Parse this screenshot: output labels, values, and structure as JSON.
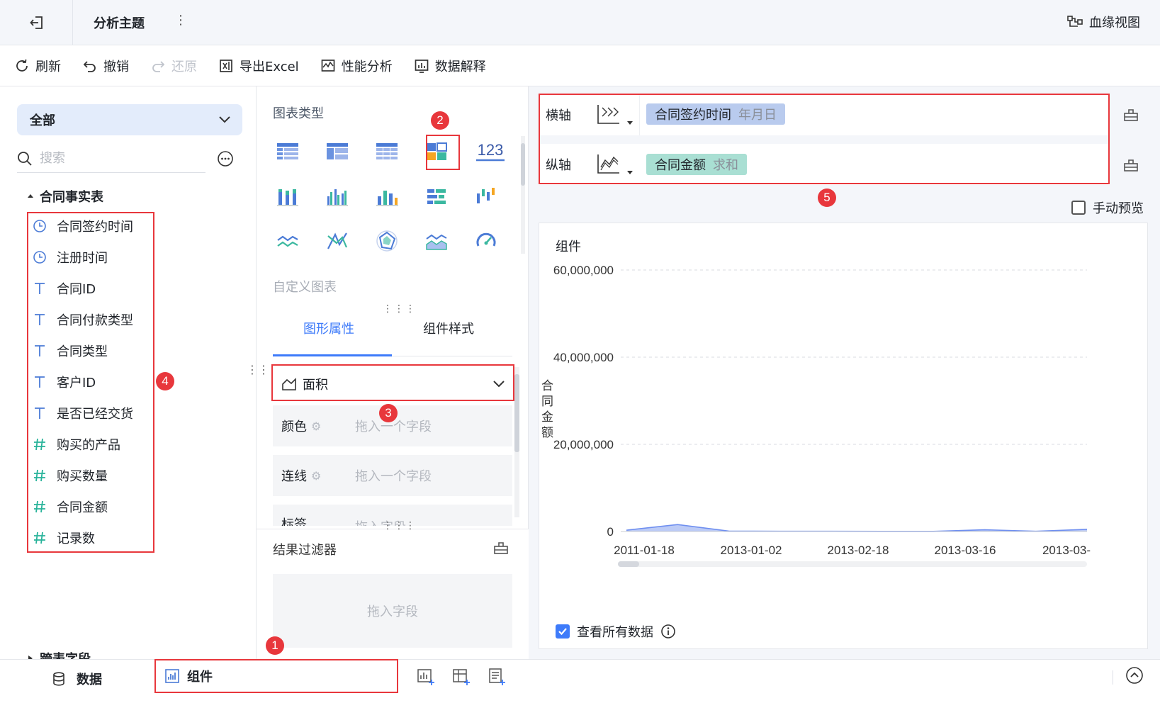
{
  "header": {
    "title": "分析主题",
    "menu_glyph": "⋮",
    "lineage_label": "血缘视图"
  },
  "toolbar": {
    "refresh": "刷新",
    "undo": "撤销",
    "redo": "还原",
    "export_excel": "导出Excel",
    "performance": "性能分析",
    "data_explain": "数据解释"
  },
  "left": {
    "scope": "全部",
    "search_placeholder": "搜索",
    "table_name": "合同事实表",
    "fields": [
      {
        "label": "合同签约时间",
        "type": "date"
      },
      {
        "label": "注册时间",
        "type": "date"
      },
      {
        "label": "合同ID",
        "type": "text"
      },
      {
        "label": "合同付款类型",
        "type": "text"
      },
      {
        "label": "合同类型",
        "type": "text"
      },
      {
        "label": "客户ID",
        "type": "text"
      },
      {
        "label": "是否已经交货",
        "type": "text"
      },
      {
        "label": "购买的产品",
        "type": "number"
      },
      {
        "label": "购买数量",
        "type": "number"
      },
      {
        "label": "合同金额",
        "type": "number"
      },
      {
        "label": "记录数",
        "type": "number"
      }
    ],
    "cross_table": "跨表字段"
  },
  "middle": {
    "chart_types_title": "图表类型",
    "number_icon_label": "123",
    "custom_chart": "自定义图表",
    "tabs": [
      "图形属性",
      "组件样式"
    ],
    "chart_type_value": "面积",
    "slots": [
      {
        "label": "颜色",
        "placeholder": "拖入一个字段"
      },
      {
        "label": "连线",
        "placeholder": "拖入一个字段"
      },
      {
        "label": "标签",
        "placeholder": "拖入字段"
      }
    ],
    "filter_title": "结果过滤器",
    "filter_placeholder": "拖入字段"
  },
  "right": {
    "x_axis": {
      "label": "横轴",
      "field": "合同签约时间",
      "agg": "年月日"
    },
    "y_axis": {
      "label": "纵轴",
      "field": "合同金额",
      "agg": "求和"
    },
    "manual_preview": "手动预览",
    "card_title": "组件",
    "view_all": "查看所有数据"
  },
  "bottom": {
    "data_tab": "数据",
    "component_tab": "组件"
  },
  "badges": [
    "1",
    "2",
    "3",
    "4",
    "5"
  ],
  "colors": {
    "accent": "#3e7bfa",
    "highlight": "#e8373c",
    "x_pill": "#b9cbee",
    "y_pill": "#a9dfd3",
    "area": "#6f8ff0"
  },
  "chart_data": {
    "type": "area",
    "ylabel": "合同金额",
    "yticks": [
      "60,000,000",
      "40,000,000",
      "20,000,000",
      "0"
    ],
    "ylim": [
      0,
      60000000
    ],
    "x": [
      "2011-01-18",
      "2013-01-02",
      "2013-02-18",
      "2013-03-16",
      "2013-03-"
    ],
    "series": [
      {
        "values": [
          300000,
          1600000,
          100000,
          50000,
          50000,
          30000,
          30000,
          400000,
          60000,
          500000
        ]
      }
    ],
    "grid": true
  }
}
